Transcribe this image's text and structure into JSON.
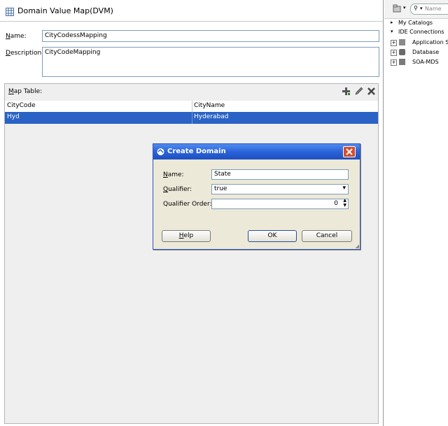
{
  "editor": {
    "title": "Domain Value Map(DVM)",
    "name_label": "Name:",
    "name_value": "CityCodessMapping",
    "description_label": "Description:",
    "description_value": "CityCodeMapping",
    "map_table_label": "Map Table:",
    "columns": [
      "CityCode",
      "CityName"
    ],
    "rows": [
      {
        "city_code": "Hyd",
        "city_name": "Hyderabad"
      }
    ]
  },
  "side_panel": {
    "search_placeholder": "Name",
    "items": [
      {
        "label": "My Catalogs"
      },
      {
        "label": "IDE Connections"
      },
      {
        "label": "Application S"
      },
      {
        "label": "Database"
      },
      {
        "label": "SOA-MDS"
      }
    ]
  },
  "dialog": {
    "title": "Create Domain",
    "name_label": "Name:",
    "name_value": "State",
    "qualifier_label": "Qualifier:",
    "qualifier_value": "true",
    "qualifier_order_label": "Qualifier Order:",
    "qualifier_order_value": "0",
    "help_label": "Help",
    "ok_label": "OK",
    "cancel_label": "Cancel"
  },
  "colors": {
    "selection": "#2a63c5",
    "dialog_title": "#2a63d8",
    "dialog_bg": "#ece9d8",
    "panel_bg": "#efefef"
  }
}
